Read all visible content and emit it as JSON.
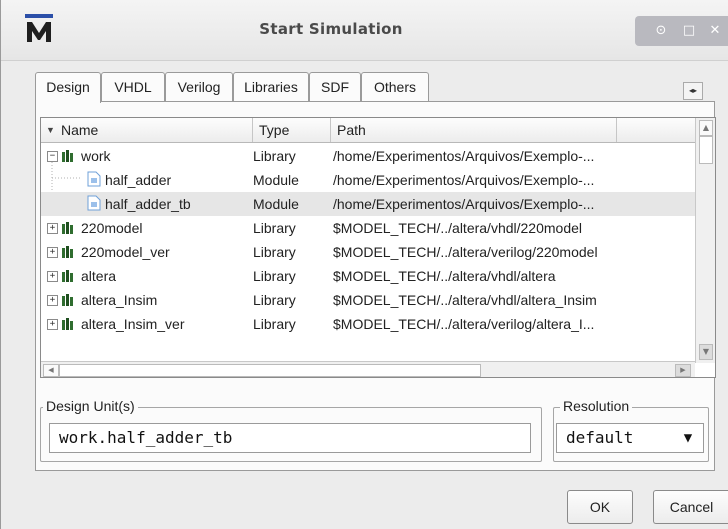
{
  "window": {
    "title": "Start Simulation",
    "controls": [
      "up",
      "maximize",
      "close"
    ]
  },
  "tabs": [
    {
      "label": "Design",
      "active": true
    },
    {
      "label": "VHDL",
      "active": false
    },
    {
      "label": "Verilog",
      "active": false
    },
    {
      "label": "Libraries",
      "active": false
    },
    {
      "label": "SDF",
      "active": false
    },
    {
      "label": "Others",
      "active": false
    }
  ],
  "table": {
    "columns": [
      "Name",
      "Type",
      "Path"
    ],
    "rows": [
      {
        "name": "work",
        "type": "Library",
        "path": "/home/Experimentos/Arquivos/Exemplo-...",
        "expander": "−",
        "icon": "library-icon",
        "level": 0
      },
      {
        "name": "half_adder",
        "type": "Module",
        "path": "/home/Experimentos/Arquivos/Exemplo-...",
        "expander": "",
        "icon": "module-icon",
        "level": 1
      },
      {
        "name": "half_adder_tb",
        "type": "Module",
        "path": "/home/Experimentos/Arquivos/Exemplo-...",
        "expander": "",
        "icon": "module-icon",
        "level": 1,
        "selected": true
      },
      {
        "name": "220model",
        "type": "Library",
        "path": "$MODEL_TECH/../altera/vhdl/220model",
        "expander": "+",
        "icon": "library-icon",
        "level": 0
      },
      {
        "name": "220model_ver",
        "type": "Library",
        "path": "$MODEL_TECH/../altera/verilog/220model",
        "expander": "+",
        "icon": "library-icon",
        "level": 0
      },
      {
        "name": "altera",
        "type": "Library",
        "path": "$MODEL_TECH/../altera/vhdl/altera",
        "expander": "+",
        "icon": "library-icon",
        "level": 0
      },
      {
        "name": "altera_Insim",
        "type": "Library",
        "path": "$MODEL_TECH/../altera/vhdl/altera_Insim",
        "expander": "+",
        "icon": "library-icon",
        "level": 0
      },
      {
        "name": "altera_Insim_ver",
        "type": "Library",
        "path": "$MODEL_TECH/../altera/verilog/altera_I...",
        "expander": "+",
        "icon": "library-icon",
        "level": 0
      }
    ]
  },
  "design_units": {
    "label": "Design Unit(s)",
    "value": "work.half_adder_tb"
  },
  "resolution": {
    "label": "Resolution",
    "value": "default"
  },
  "buttons": {
    "ok": "OK",
    "cancel": "Cancel"
  },
  "colors": {
    "selected_row": "#e6e6e6",
    "library_icon": "#2f6d2f",
    "module_icon": "#6fa0d8"
  }
}
